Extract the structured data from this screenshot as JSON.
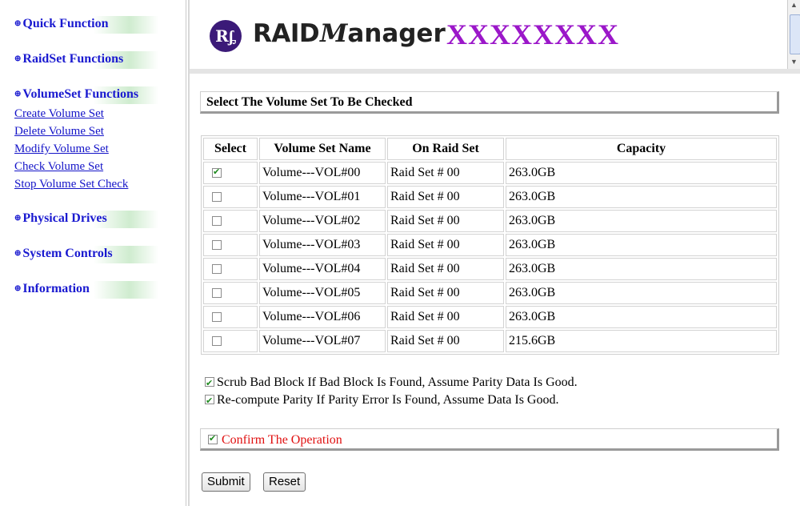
{
  "sidebar": {
    "quick_function": "Quick Function",
    "raidset_functions": "RaidSet Functions",
    "volumeset_functions": "VolumeSet Functions",
    "volumeset_links": [
      "Create Volume Set",
      "Delete Volume Set",
      "Modify Volume Set",
      "Check Volume Set",
      "Stop Volume Set Check"
    ],
    "physical_drives": "Physical Drives",
    "system_controls": "System Controls",
    "information": "Information",
    "section_marker": "⊕"
  },
  "header": {
    "logo_mark": "Rᶋ",
    "logo_raid": "RAID",
    "logo_manager_m": "M",
    "logo_manager_rest": "anager",
    "product_name": "XXXXXXXX"
  },
  "main": {
    "section_title": "Select The Volume Set To Be Checked",
    "columns": [
      "Select",
      "Volume Set Name",
      "On Raid Set",
      "Capacity"
    ],
    "rows": [
      {
        "selected": true,
        "name": "Volume---VOL#00",
        "raid_set": "Raid Set # 00",
        "capacity": "263.0GB"
      },
      {
        "selected": false,
        "name": "Volume---VOL#01",
        "raid_set": "Raid Set # 00",
        "capacity": "263.0GB"
      },
      {
        "selected": false,
        "name": "Volume---VOL#02",
        "raid_set": "Raid Set # 00",
        "capacity": "263.0GB"
      },
      {
        "selected": false,
        "name": "Volume---VOL#03",
        "raid_set": "Raid Set # 00",
        "capacity": "263.0GB"
      },
      {
        "selected": false,
        "name": "Volume---VOL#04",
        "raid_set": "Raid Set # 00",
        "capacity": "263.0GB"
      },
      {
        "selected": false,
        "name": "Volume---VOL#05",
        "raid_set": "Raid Set # 00",
        "capacity": "263.0GB"
      },
      {
        "selected": false,
        "name": "Volume---VOL#06",
        "raid_set": "Raid Set # 00",
        "capacity": "263.0GB"
      },
      {
        "selected": false,
        "name": "Volume---VOL#07",
        "raid_set": "Raid Set # 00",
        "capacity": "215.6GB"
      }
    ],
    "option_scrub": "Scrub Bad Block If Bad Block Is Found, Assume Parity Data Is Good.",
    "option_scrub_checked": true,
    "option_recompute": "Re-compute Parity If Parity Error Is Found, Assume Data Is Good.",
    "option_recompute_checked": true,
    "confirm_label": "Confirm The Operation",
    "confirm_checked": true,
    "submit_label": "Submit",
    "reset_label": "Reset"
  },
  "colors": {
    "section_link": "#1a1ad0",
    "product_name": "#9b17c9",
    "confirm_text": "#e01010",
    "checkmark": "#1f8a1f"
  }
}
